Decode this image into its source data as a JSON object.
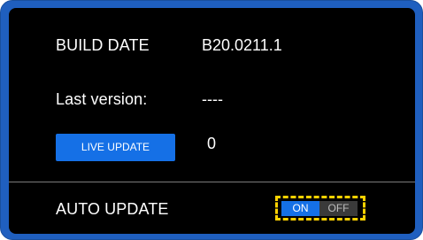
{
  "build": {
    "label": "BUILD DATE",
    "value": "B20.0211.1"
  },
  "version": {
    "label": "Last version:",
    "value": "----"
  },
  "live_update": {
    "button_label": "LIVE UPDATE",
    "count": "0"
  },
  "auto_update": {
    "label": "AUTO UPDATE",
    "on_label": "ON",
    "off_label": "OFF",
    "state": "ON"
  },
  "colors": {
    "frame": "#1f5fbf",
    "panel": "#000000",
    "accent": "#1570e6",
    "highlight": "#ffd200"
  }
}
